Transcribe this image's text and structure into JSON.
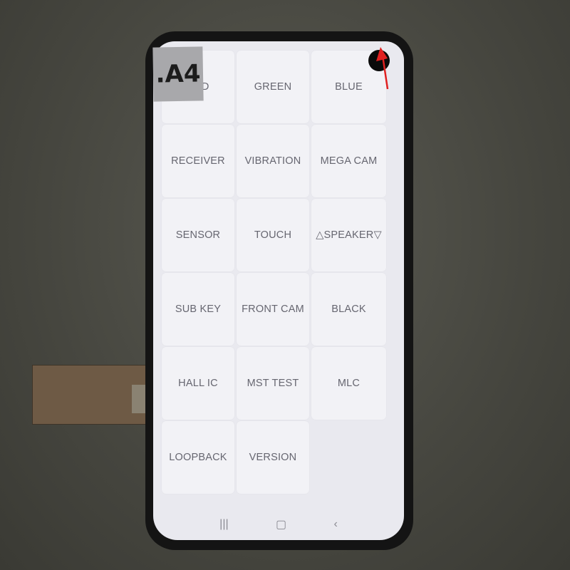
{
  "sticker_label": ".A4",
  "tiles": [
    "RED",
    "GREEN",
    "BLUE",
    "RECEIVER",
    "VIBRATION",
    "MEGA CAM",
    "SENSOR",
    "TOUCH",
    "△SPEAKER▽",
    "SUB KEY",
    "FRONT CAM",
    "BLACK",
    "HALL IC",
    "MST TEST",
    "MLC",
    "LOOPBACK",
    "VERSION"
  ],
  "nav": {
    "recents": "|||",
    "home": "▢",
    "back": "‹"
  },
  "colors": {
    "screen": "#e9e9ef",
    "tile": "#f2f2f6",
    "text": "#666670",
    "annotation_arrow": "#e02020"
  }
}
